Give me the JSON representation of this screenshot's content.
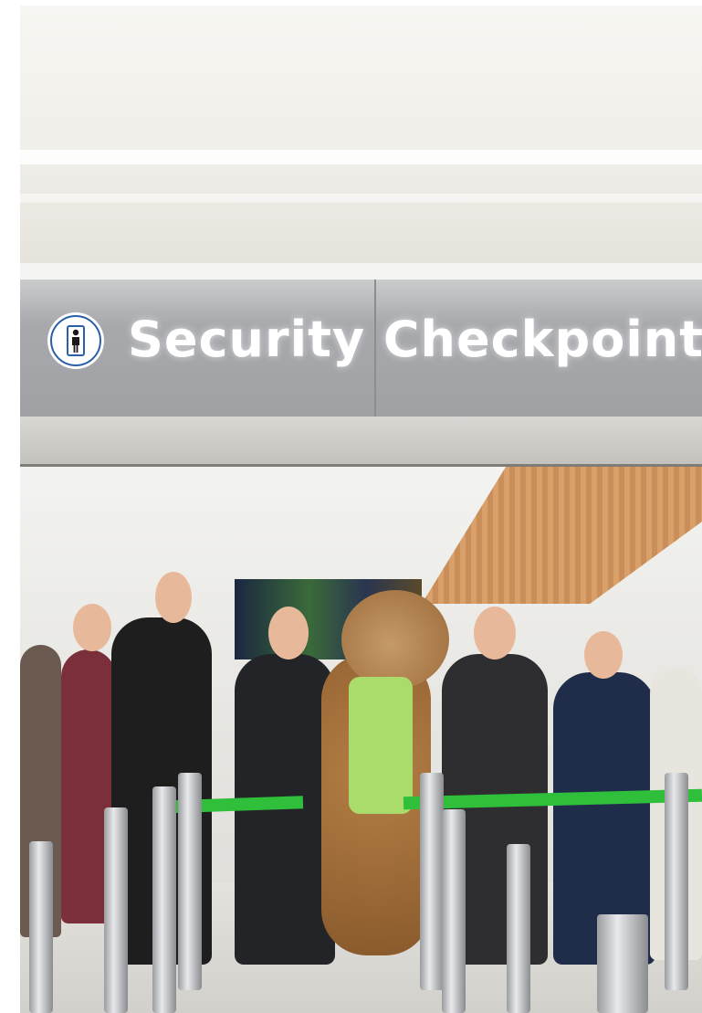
{
  "scene": {
    "sign": {
      "text": "Security Checkpoint",
      "icon": "person-silhouette-icon"
    },
    "colors": {
      "sign_panel": "#a7a9ad",
      "sign_text": "#ffffff",
      "ribbon": "#2fbf3a",
      "wood_wall": "#d9a06a"
    }
  }
}
